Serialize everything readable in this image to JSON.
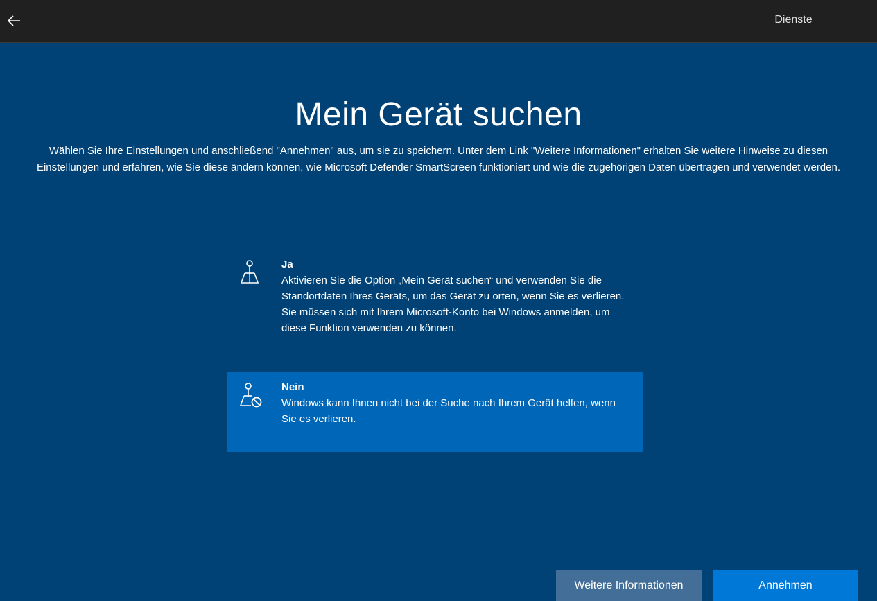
{
  "header": {
    "back_icon": "arrow-left-icon",
    "tab_label": "Dienste"
  },
  "main": {
    "title": "Mein Gerät suchen",
    "description": "Wählen Sie Ihre Einstellungen und anschließend \"Annehmen\" aus, um sie zu speichern. Unter dem Link \"Weitere Informationen\" erhalten Sie weitere Hinweise zu diesen Einstellungen und erfahren, wie Sie diese ändern können, wie Microsoft Defender SmartScreen funktioniert und wie die zugehörigen Daten übertragen und verwendet werden.",
    "options": [
      {
        "title": "Ja",
        "text": "Aktivieren Sie die Option „Mein Gerät suchen“ und verwenden Sie die Standortdaten Ihres Geräts, um das Gerät zu orten, wenn Sie es verlieren. Sie müssen sich mit Ihrem Microsoft-Konto bei Windows anmelden, um diese Funktion verwenden zu können.",
        "icon": "location-pin-map-icon",
        "selected": false
      },
      {
        "title": "Nein",
        "text": "Windows kann Ihnen nicht bei der Suche nach Ihrem Gerät helfen, wenn Sie es verlieren.",
        "icon": "location-pin-blocked-icon",
        "selected": true
      }
    ]
  },
  "footer": {
    "more_info_label": "Weitere Informationen",
    "accept_label": "Annehmen"
  },
  "colors": {
    "background": "#004275",
    "topbar": "#202020",
    "selected_option": "#0067b8",
    "accept_button": "#0078d7",
    "more_info_button": "#426e97"
  }
}
